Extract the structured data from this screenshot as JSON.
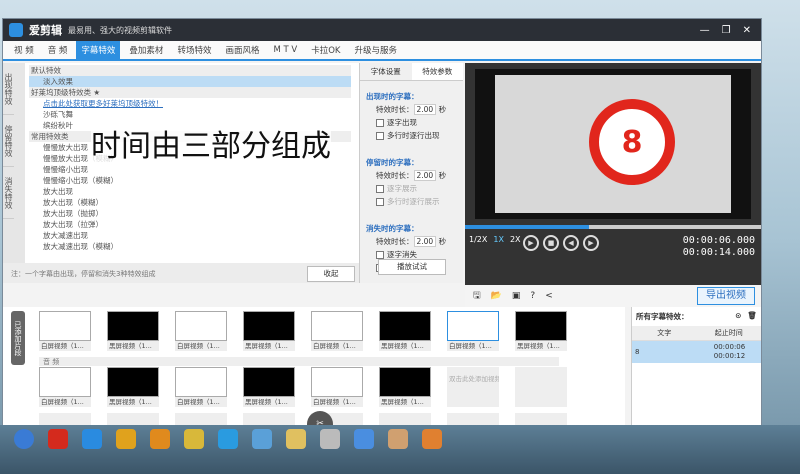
{
  "app": {
    "name": "爱剪辑",
    "slogan": "最易用、强大的视频剪辑软件"
  },
  "tabs": [
    "视 频",
    "音 频",
    "字幕特效",
    "叠加素材",
    "转场特效",
    "画面风格",
    "M T V",
    "卡拉OK",
    "升级与服务"
  ],
  "active_tab": "字幕特效",
  "vtabs": [
    "出现特效",
    "停留特效",
    "消失特效"
  ],
  "effects": [
    {
      "t": "默认特效",
      "k": "group"
    },
    {
      "t": "淡入效果",
      "k": "sel"
    },
    {
      "t": "好莱坞顶级特效类 ★",
      "k": "group"
    },
    {
      "t": "点击此处获取更多好莱坞顶级特效！",
      "k": "link"
    },
    {
      "t": "沙砾飞舞",
      "k": ""
    },
    {
      "t": "缤纷秋叶",
      "k": ""
    },
    {
      "t": "常用特效类",
      "k": "group"
    },
    {
      "t": "慢慢放大出现",
      "k": ""
    },
    {
      "t": "慢慢放大出现（模糊）",
      "k": ""
    },
    {
      "t": "慢慢缩小出现",
      "k": ""
    },
    {
      "t": "慢慢缩小出现（模糊）",
      "k": ""
    },
    {
      "t": "放大出现",
      "k": ""
    },
    {
      "t": "放大出现（模糊）",
      "k": ""
    },
    {
      "t": "放大出现（抛掷）",
      "k": ""
    },
    {
      "t": "放大出现（拉弹）",
      "k": ""
    },
    {
      "t": "放大减速出现",
      "k": ""
    },
    {
      "t": "放大减速出现（模糊）",
      "k": ""
    }
  ],
  "overlay_text": "时间由三部分组成",
  "params": {
    "tabs": [
      "字体设置",
      "特效参数"
    ],
    "appear": {
      "title": "出现时的字幕：",
      "duration_label": "特效时长：",
      "duration": "2.00",
      "unit": "秒",
      "opt1": "逐字出现",
      "opt2": "多行时逐行出现"
    },
    "stay": {
      "title": "停留时的字幕：",
      "duration_label": "特效时长：",
      "duration": "2.00",
      "unit": "秒",
      "opt1": "逐字展示",
      "opt2": "多行时逐行展示"
    },
    "vanish": {
      "title": "消失时的字幕：",
      "duration_label": "特效时长：",
      "duration": "2.00",
      "unit": "秒",
      "opt1": "逐字消失",
      "opt2": "多行时逐行消失"
    }
  },
  "note": "注：一个字幕由出现，停留和消失3种特效组成",
  "collapse_label": "收起",
  "play_try_label": "播放试试",
  "preview": {
    "countdown": "8",
    "progress": 0.42,
    "speeds": [
      "1/2X",
      "1X",
      "2X"
    ],
    "time_current": "00:00:06.000",
    "time_total": "00:00:14.000"
  },
  "export_label": "导出视频",
  "timeline": {
    "label": "已添加片段",
    "audio_label": "音 频",
    "row1": [
      "白屏视频（1...",
      "黑屏视频（1...",
      "白屏视频（1...",
      "黑屏视频（1...",
      "白屏视频（1...",
      "黑屏视频（1...",
      "白屏视频（1...",
      "黑屏视频（1..."
    ],
    "row2": [
      "白屏视频（1...",
      "黑屏视频（1...",
      "白屏视频（1...",
      "黑屏视频（1...",
      "白屏视频（1...",
      "黑屏视频（1..."
    ],
    "add_placeholder": "双击此处添加视频"
  },
  "subtitles": {
    "title": "所有字幕特效：",
    "col_text": "文字",
    "col_time": "起止时间",
    "rows": [
      {
        "text": "8",
        "start": "00:00:06",
        "end": "00:00:12"
      }
    ]
  },
  "colors": {
    "accent": "#2d8fe0",
    "countdown": "#e1261c"
  }
}
